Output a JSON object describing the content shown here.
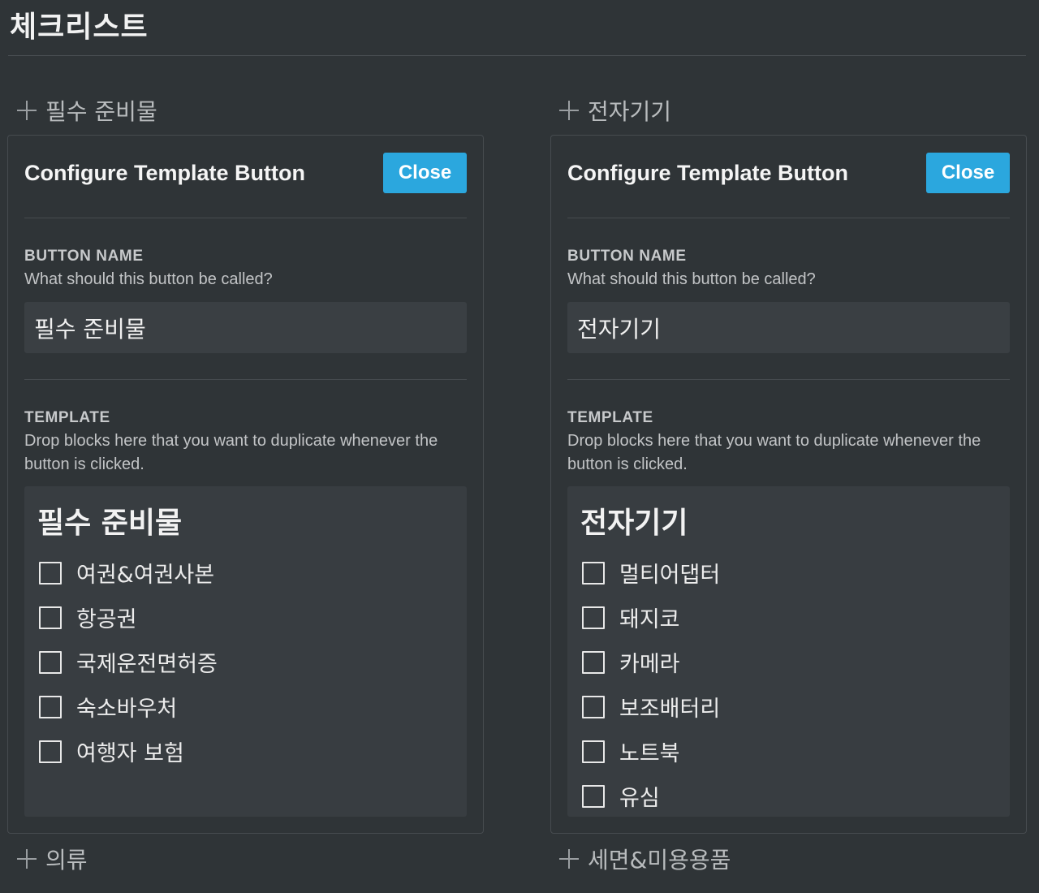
{
  "page": {
    "title": "체크리스트"
  },
  "add_buttons": {
    "top_left": "필수 준비물",
    "top_right": "전자기기",
    "bottom_left": "의류",
    "bottom_right": "세면&미용용품"
  },
  "panels": [
    {
      "title": "Configure Template Button",
      "close_label": "Close",
      "button_name": {
        "label": "BUTTON NAME",
        "description": "What should this button be called?",
        "value": "필수 준비물"
      },
      "template": {
        "label": "TEMPLATE",
        "description": "Drop blocks here that you want to duplicate whenever the button is clicked.",
        "heading": "필수 준비물",
        "items": [
          "여권&여권사본",
          "항공권",
          "국제운전면허증",
          "숙소바우처",
          "여행자 보험"
        ]
      }
    },
    {
      "title": "Configure Template Button",
      "close_label": "Close",
      "button_name": {
        "label": "BUTTON NAME",
        "description": "What should this button be called?",
        "value": "전자기기"
      },
      "template": {
        "label": "TEMPLATE",
        "description": "Drop blocks here that you want to duplicate whenever the button is clicked.",
        "heading": "전자기기",
        "items": [
          "멀티어댑터",
          "돼지코",
          "카메라",
          "보조배터리",
          "노트북",
          "유심"
        ]
      }
    }
  ],
  "colors": {
    "background": "#2f3437",
    "accent": "#2ba7de",
    "input_bg": "#3a3f43",
    "template_bg": "#383d41"
  }
}
